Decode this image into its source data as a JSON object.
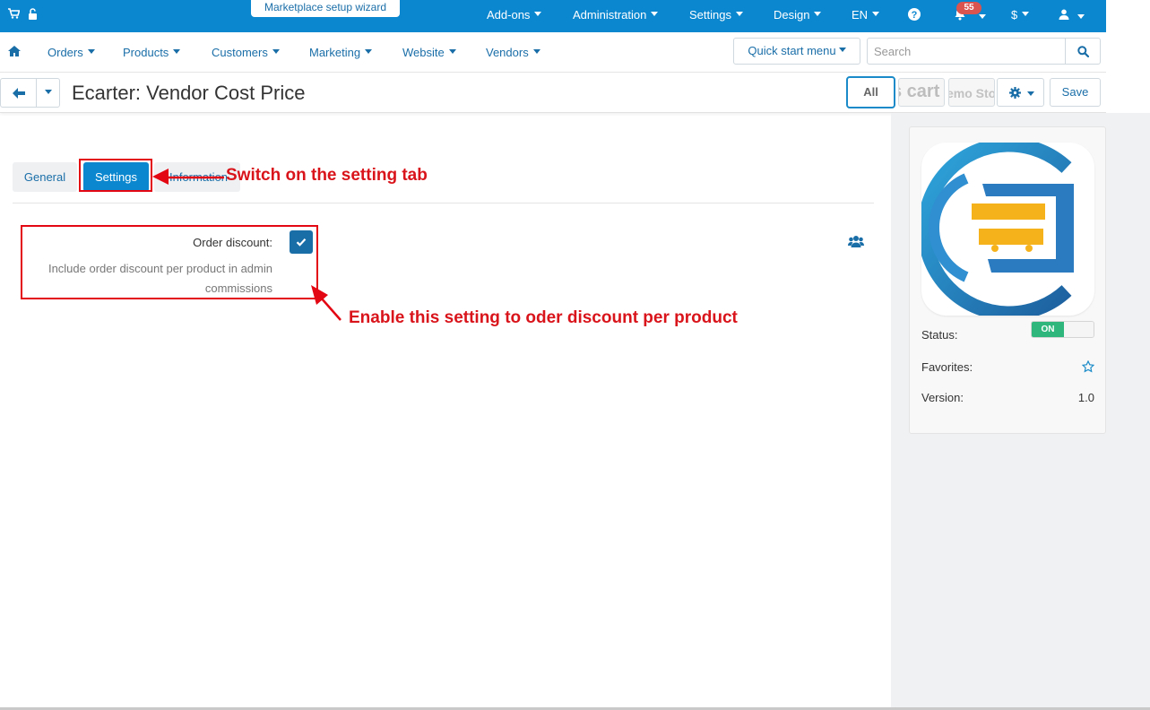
{
  "topbar": {
    "wizard_label": "Marketplace setup wizard",
    "addons": "Add-ons",
    "administration": "Administration",
    "settings": "Settings",
    "design": "Design",
    "language": "EN",
    "notifications_count": "55",
    "currency": "$"
  },
  "nav": {
    "orders": "Orders",
    "products": "Products",
    "customers": "Customers",
    "marketing": "Marketing",
    "website": "Website",
    "vendors": "Vendors",
    "quick_start": "Quick start menu",
    "search_placeholder": "Search"
  },
  "titlebar": {
    "title": "Ecarter: Vendor Cost Price",
    "all_label": "All",
    "store1_label": "s cart",
    "store2_label": "emo Sto",
    "save_label": "Save"
  },
  "tabs": {
    "general": "General",
    "settings": "Settings",
    "information": "Information"
  },
  "setting": {
    "label": "Order discount:",
    "checked": true,
    "help": "Include order discount per product in admin commissions"
  },
  "annotations": {
    "tab_note": "Switch on the setting tab",
    "setting_note": "Enable this setting to oder discount per product"
  },
  "sidebar": {
    "status_label": "Status:",
    "status_value": "ON",
    "favorites_label": "Favorites:",
    "version_label": "Version:",
    "version_value": "1.0"
  },
  "colors": {
    "primary": "#0b87d0",
    "link": "#1a6ea8",
    "annotation": "#e30613",
    "toggle_on": "#2eb67d",
    "badge": "#d9534f"
  }
}
